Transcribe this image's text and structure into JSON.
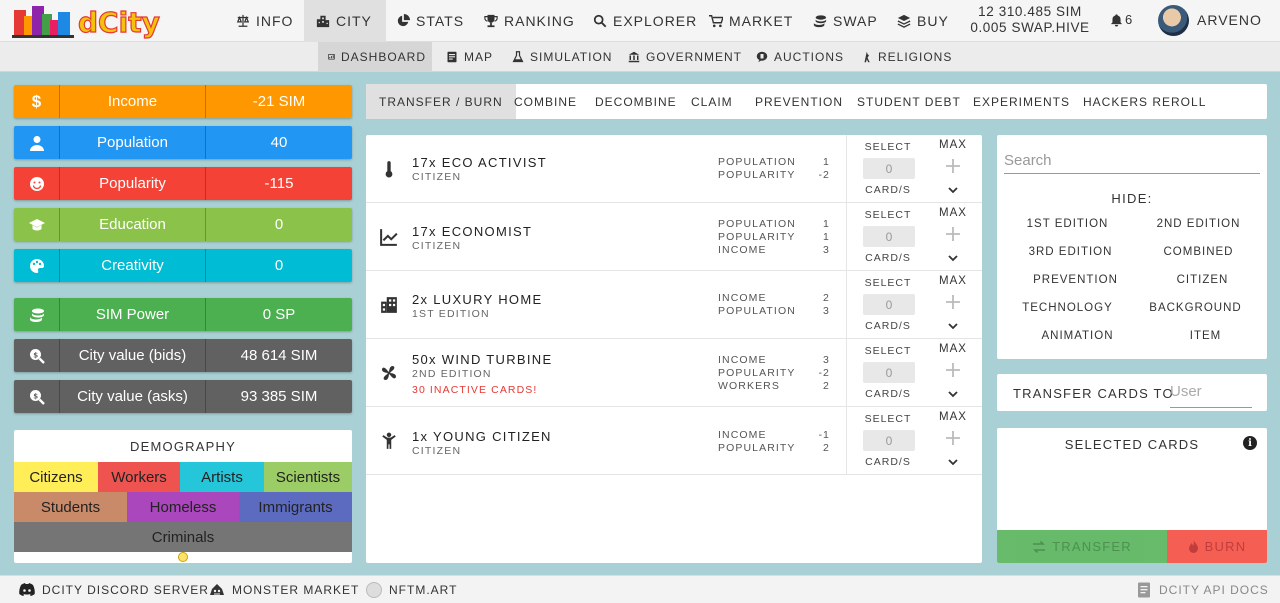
{
  "app": {
    "logo_text": "dCity"
  },
  "nav": {
    "items": [
      {
        "label": "INFO",
        "icon": "balance-scale-icon"
      },
      {
        "label": "CITY",
        "icon": "city-icon"
      },
      {
        "label": "STATS",
        "icon": "pie-chart-icon"
      },
      {
        "label": "RANKING",
        "icon": "trophy-icon"
      },
      {
        "label": "EXPLORER",
        "icon": "search-icon"
      },
      {
        "label": "MARKET",
        "icon": "cart-icon"
      },
      {
        "label": "SWAP",
        "icon": "coins-icon"
      },
      {
        "label": "BUY",
        "icon": "layers-icon"
      }
    ],
    "active": "CITY",
    "balance_sim": "12 310.485 SIM",
    "balance_swap": "0.005 SWAP.HIVE",
    "notifications": "6",
    "username": "ARVENO"
  },
  "subnav": {
    "items": [
      {
        "label": "DASHBOARD",
        "icon": "dashboard-icon"
      },
      {
        "label": "MAP",
        "icon": "map-icon"
      },
      {
        "label": "SIMULATION",
        "icon": "flask-icon"
      },
      {
        "label": "GOVERNMENT",
        "icon": "government-icon"
      },
      {
        "label": "AUCTIONS",
        "icon": "auction-icon"
      },
      {
        "label": "RELIGIONS",
        "icon": "religion-icon"
      }
    ],
    "active": "DASHBOARD"
  },
  "stats": [
    {
      "label": "Income",
      "value": "-21 SIM",
      "color": "#ff9800",
      "icon": "dollar-icon"
    },
    {
      "label": "Population",
      "value": "40",
      "color": "#2196f3",
      "icon": "user-icon"
    },
    {
      "label": "Popularity",
      "value": "-115",
      "color": "#f44336",
      "icon": "smile-icon"
    },
    {
      "label": "Education",
      "value": "0",
      "color": "#8bc34a",
      "icon": "graduation-cap-icon"
    },
    {
      "label": "Creativity",
      "value": "0",
      "color": "#00bcd4",
      "icon": "palette-icon"
    },
    {
      "label": "SIM Power",
      "value": "0 SP",
      "color": "#4caf50",
      "icon": "coins-icon"
    },
    {
      "label": "City value (bids)",
      "value": "48 614 SIM",
      "color": "#616161",
      "icon": "search-dollar-icon"
    },
    {
      "label": "City value (asks)",
      "value": "93 385 SIM",
      "color": "#616161",
      "icon": "search-dollar-icon"
    }
  ],
  "demography": {
    "title": "DEMOGRAPHY",
    "groups": [
      {
        "label": "Citizens",
        "color": "#ffee58"
      },
      {
        "label": "Workers",
        "color": "#ef5350"
      },
      {
        "label": "Artists",
        "color": "#26c6da"
      },
      {
        "label": "Scientists",
        "color": "#9ccc65"
      },
      {
        "label": "Students",
        "color": "#c98a6a"
      },
      {
        "label": "Homeless",
        "color": "#ab47bc"
      },
      {
        "label": "Immigrants",
        "color": "#5c6bc0"
      },
      {
        "label": "Criminals",
        "color": "#757575"
      }
    ]
  },
  "tabs": {
    "items": [
      "TRANSFER / BURN",
      "COMBINE",
      "DECOMBINE",
      "CLAIM",
      "PREVENTION",
      "STUDENT DEBT",
      "EXPERIMENTS",
      "HACKERS REROLL"
    ],
    "active": "TRANSFER / BURN"
  },
  "cards": [
    {
      "name": "17x ECO ACTIVIST",
      "sub": "CITIZEN",
      "warn": "",
      "icon": "thermometer-icon",
      "stats": [
        [
          "POPULATION",
          "1"
        ],
        [
          "POPULARITY",
          "-2"
        ]
      ]
    },
    {
      "name": "17x ECONOMIST",
      "sub": "CITIZEN",
      "warn": "",
      "icon": "chart-line-icon",
      "stats": [
        [
          "POPULATION",
          "1"
        ],
        [
          "POPULARITY",
          "1"
        ],
        [
          "INCOME",
          "3"
        ]
      ]
    },
    {
      "name": "2x LUXURY HOME",
      "sub": "1ST EDITION",
      "warn": "",
      "icon": "building-icon",
      "stats": [
        [
          "INCOME",
          "2"
        ],
        [
          "POPULATION",
          "3"
        ]
      ]
    },
    {
      "name": "50x WIND TURBINE",
      "sub": "2ND EDITION",
      "warn": "30 INACTIVE CARDS!",
      "icon": "fan-icon",
      "stats": [
        [
          "INCOME",
          "3"
        ],
        [
          "POPULARITY",
          "-2"
        ],
        [
          "WORKERS",
          "2"
        ]
      ]
    },
    {
      "name": "1x YOUNG CITIZEN",
      "sub": "CITIZEN",
      "warn": "",
      "icon": "child-icon",
      "stats": [
        [
          "INCOME",
          "-1"
        ],
        [
          "POPULARITY",
          "2"
        ]
      ]
    }
  ],
  "card_controls": {
    "select_label": "SELECT",
    "value": "0",
    "per_label": "CARD/S",
    "max_label": "MAX"
  },
  "filter": {
    "search_placeholder": "Search",
    "hide_title": "HIDE:",
    "options": [
      "1ST EDITION",
      "2ND EDITION",
      "3RD EDITION",
      "COMBINED",
      "PREVENTION",
      "CITIZEN",
      "TECHNOLOGY",
      "BACKGROUND",
      "ANIMATION",
      "ITEM"
    ]
  },
  "transfer": {
    "label": "TRANSFER CARDS TO",
    "placeholder": "User"
  },
  "selected": {
    "title": "SELECTED CARDS",
    "transfer_label": "TRANSFER",
    "burn_label": "BURN"
  },
  "footer": {
    "links": [
      {
        "label": "DCITY DISCORD SERVER",
        "icon": "discord-icon"
      },
      {
        "label": "MONSTER MARKET",
        "icon": "monster-icon"
      },
      {
        "label": "NFTM.ART",
        "icon": "nftm-icon"
      },
      {
        "label": "DCITY API DOCS",
        "icon": "document-icon"
      }
    ]
  }
}
